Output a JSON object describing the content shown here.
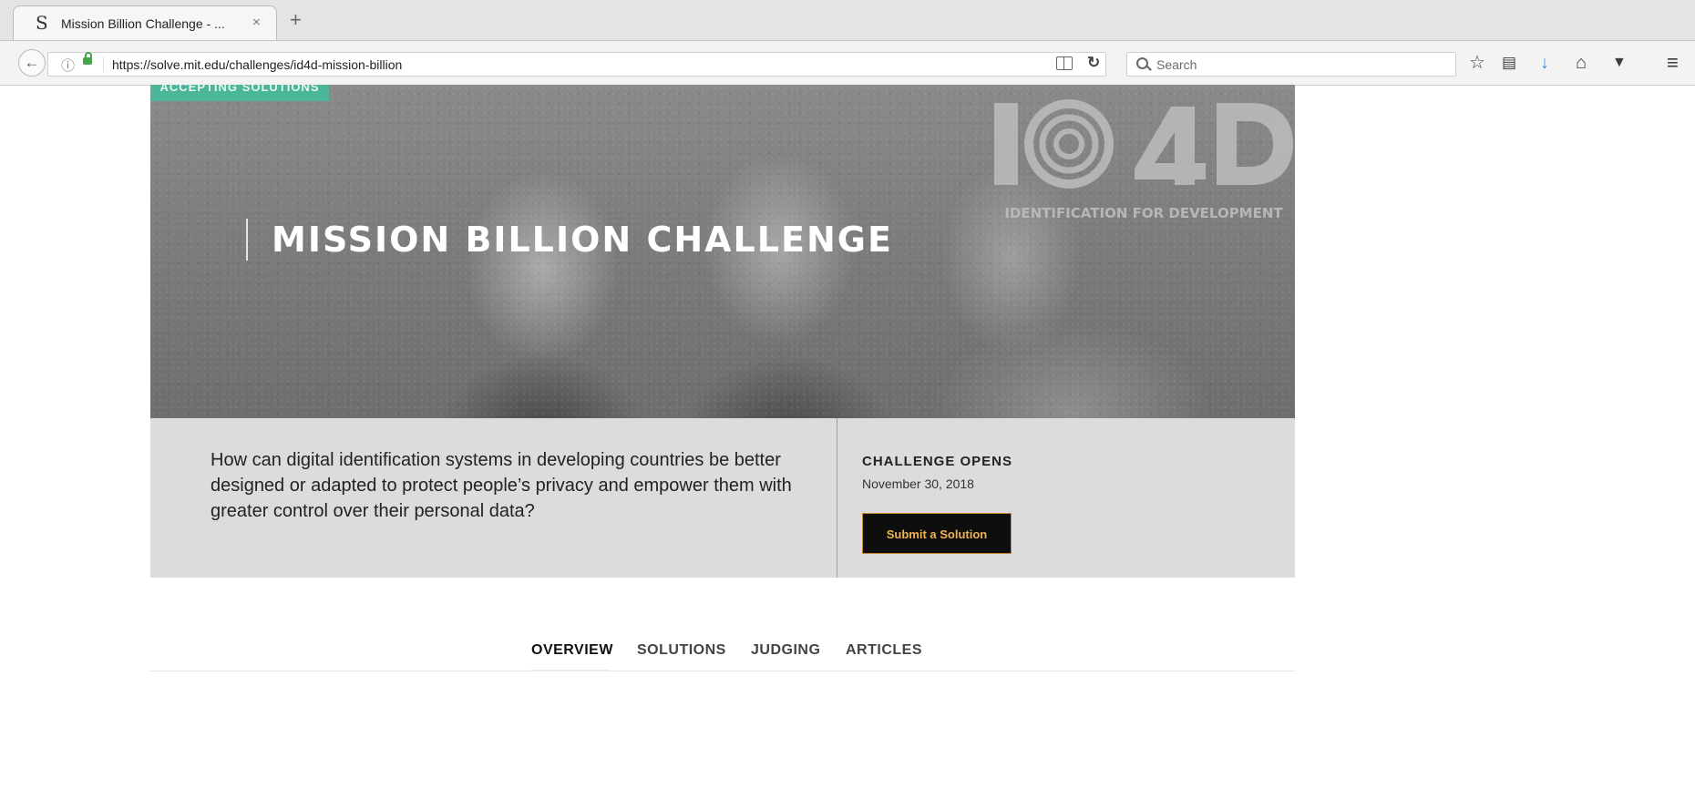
{
  "browser": {
    "tab_title": "Mission Billion Challenge - ...",
    "tab_close": "×",
    "new_tab": "+",
    "favicon": "S",
    "url": "https://solve.mit.edu/challenges/id4d-mission-billion",
    "search_placeholder": "Search",
    "icons": [
      "back-arrow-icon",
      "info-icon",
      "lock-icon",
      "reader-view-icon",
      "reload-icon",
      "search-icon",
      "bookmark-star-icon",
      "reading-list-icon",
      "download-icon",
      "home-icon",
      "pocket-icon",
      "menu-icon"
    ]
  },
  "hero": {
    "status_banner": "ACCEPTING SOLUTIONS",
    "title": "MISSION BILLION CHALLENGE",
    "partner_logo": {
      "mark": "ID4D",
      "subtitle": "IDENTIFICATION FOR DEVELOPMENT"
    }
  },
  "intro": {
    "question": "How can digital identification systems in developing countries be better designed or adapted to protect people’s privacy and empower them with greater control over their personal data?",
    "opens_label": "CHALLENGE OPENS",
    "opens_date": "November 30, 2018",
    "submit_label": "Submit a Solution"
  },
  "subnav": {
    "items": [
      "OVERVIEW",
      "SOLUTIONS",
      "JUDGING",
      "ARTICLES"
    ],
    "active": "OVERVIEW"
  },
  "colors": {
    "banner_green": "#4bb69a",
    "button_bg": "#0e0e0e",
    "button_text": "#f0b34d",
    "intro_bg": "#dcdcdc"
  }
}
